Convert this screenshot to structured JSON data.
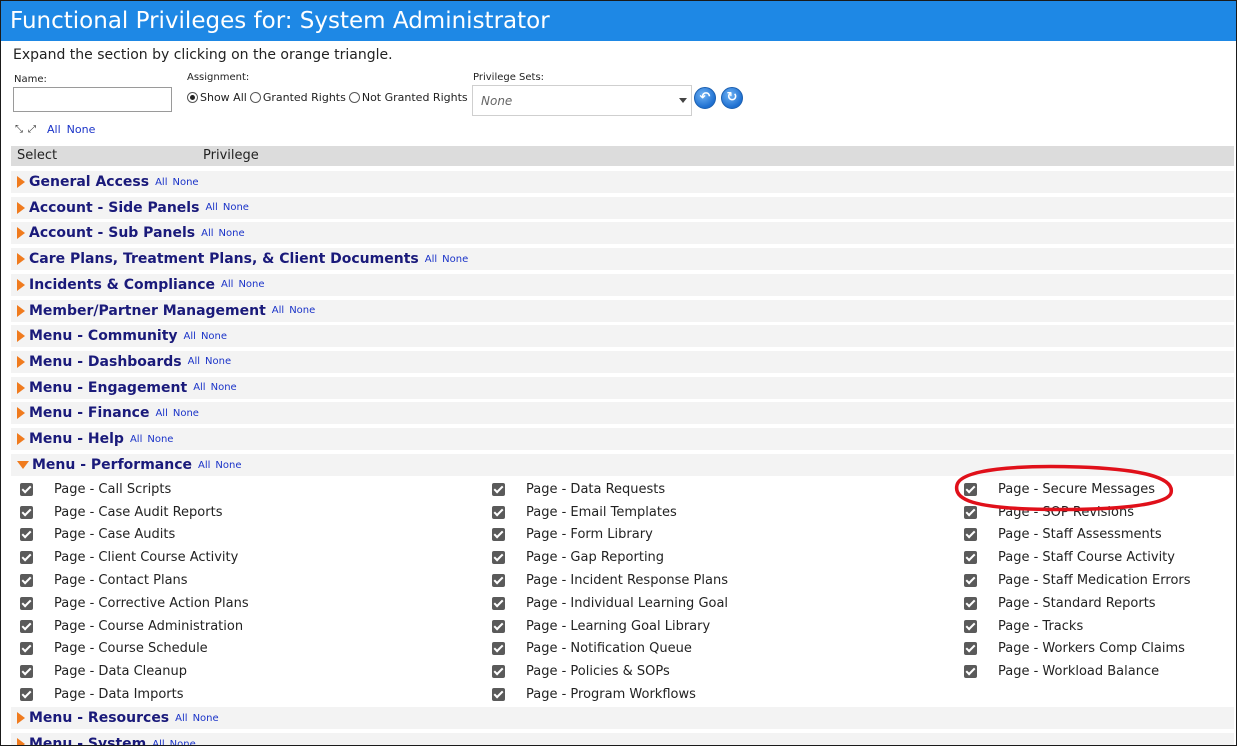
{
  "title": "Functional Privileges for: System Administrator",
  "instructions": "Expand the section by clicking on the orange triangle.",
  "filters": {
    "name_label": "Name:",
    "name_value": "",
    "assignment_label": "Assignment:",
    "assignment_options": [
      "Show All",
      "Granted Rights",
      "Not Granted Rights"
    ],
    "assignment_selected": "Show All",
    "privilege_sets_label": "Privilege Sets:",
    "privilege_sets_value": "None"
  },
  "toolbar": {
    "all_link": "All",
    "none_link": "None"
  },
  "table_header": {
    "select": "Select",
    "privilege": "Privilege"
  },
  "section_links": {
    "all": "All",
    "none": "None"
  },
  "sections": [
    {
      "name": "General Access",
      "expanded": false
    },
    {
      "name": "Account - Side Panels",
      "expanded": false
    },
    {
      "name": "Account - Sub Panels",
      "expanded": false
    },
    {
      "name": "Care Plans, Treatment Plans, & Client Documents",
      "expanded": false
    },
    {
      "name": "Incidents & Compliance",
      "expanded": false
    },
    {
      "name": "Member/Partner Management",
      "expanded": false
    },
    {
      "name": "Menu - Community",
      "expanded": false
    },
    {
      "name": "Menu - Dashboards",
      "expanded": false
    },
    {
      "name": "Menu - Engagement",
      "expanded": false
    },
    {
      "name": "Menu - Finance",
      "expanded": false
    },
    {
      "name": "Menu - Help",
      "expanded": false
    },
    {
      "name": "Menu - Performance",
      "expanded": true
    },
    {
      "name": "Menu - Resources",
      "expanded": false
    },
    {
      "name": "Menu - System",
      "expanded": false
    }
  ],
  "performance_privileges": {
    "col1": [
      "Page - Call Scripts",
      "Page - Case Audit Reports",
      "Page - Case Audits",
      "Page - Client Course Activity",
      "Page - Contact Plans",
      "Page - Corrective Action Plans",
      "Page - Course Administration",
      "Page - Course Schedule",
      "Page - Data Cleanup",
      "Page - Data Imports"
    ],
    "col2": [
      "Page - Data Requests",
      "Page - Email Templates",
      "Page - Form Library",
      "Page - Gap Reporting",
      "Page - Incident Response Plans",
      "Page - Individual Learning Goal",
      "Page - Learning Goal Library",
      "Page - Notification Queue",
      "Page - Policies & SOPs",
      "Page - Program Workflows"
    ],
    "col3": [
      "Page - Secure Messages",
      "Page - SOP Revisions",
      "Page - Staff Assessments",
      "Page - Staff Course Activity",
      "Page - Staff Medication Errors",
      "Page - Standard Reports",
      "Page - Tracks",
      "Page - Workers Comp Claims",
      "Page - Workload Balance"
    ]
  },
  "colors": {
    "title_bar": "#1e88e5",
    "triangle": "#f07b1e",
    "section_title": "#1a1a7a",
    "link": "#1a33c8",
    "annotation": "#e0101a"
  }
}
